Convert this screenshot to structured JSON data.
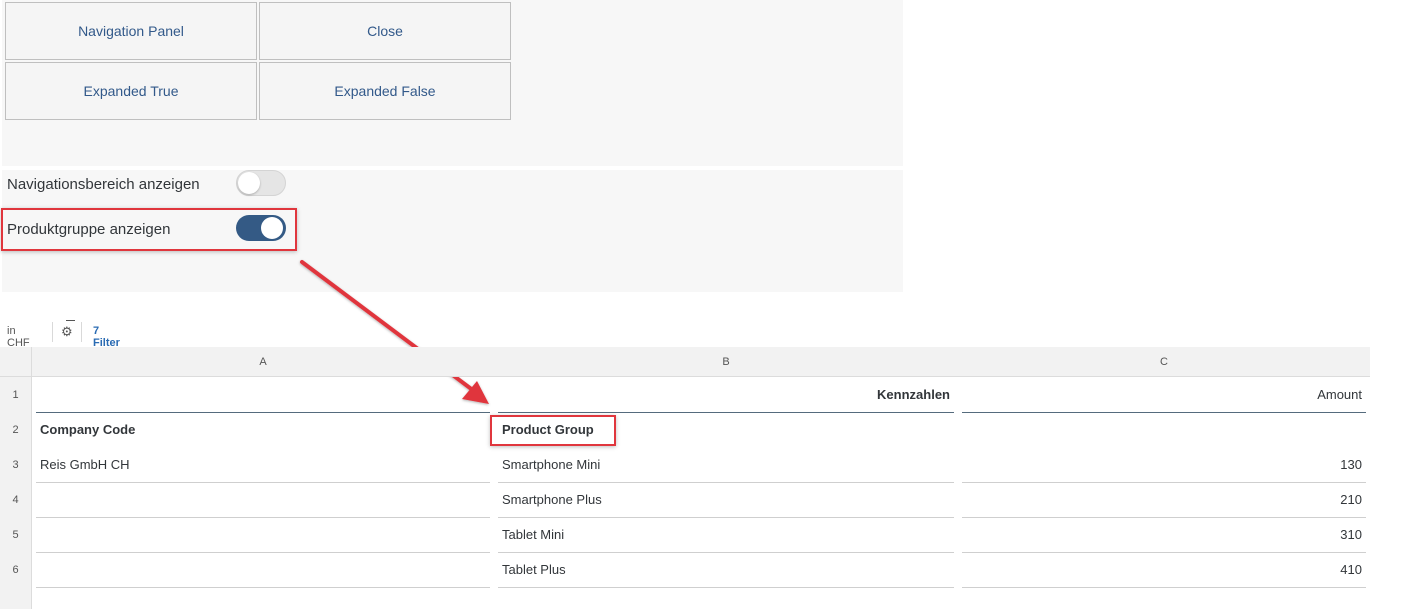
{
  "buttons": {
    "navigation_panel": "Navigation Panel",
    "close": "Close",
    "expanded_true": "Expanded True",
    "expanded_false": "Expanded False"
  },
  "switches": [
    {
      "label": "Navigationsbereich anzeigen",
      "state": "off"
    },
    {
      "label": "Produktgruppe anzeigen",
      "state": "on"
    }
  ],
  "toolbar": {
    "currency": "in CHF",
    "settings_icon": "gear-icon",
    "filter": "7 Filter"
  },
  "table": {
    "columns": [
      "A",
      "B",
      "C"
    ],
    "rows": [
      "1",
      "2",
      "3",
      "4",
      "5",
      "6"
    ],
    "header_measure": "Kennzahlen",
    "header_amount": "Amount",
    "dim_company": "Company Code",
    "dim_product": "Product Group",
    "company_value": "Reis GmbH CH",
    "products": [
      "Smartphone Mini",
      "Smartphone Plus",
      "Tablet Mini",
      "Tablet Plus"
    ],
    "amounts": [
      "130",
      "210",
      "310",
      "410"
    ]
  },
  "colors": {
    "switch_on": "#345a85",
    "highlight": "#e0363d",
    "link": "#2a6bb3",
    "button_text": "#32598a"
  }
}
